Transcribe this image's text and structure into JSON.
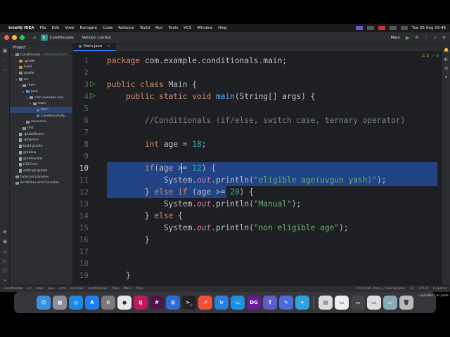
{
  "menubar": {
    "app_name": "IntelliJ IDEA",
    "items": [
      "File",
      "Edit",
      "View",
      "Navigate",
      "Code",
      "Refactor",
      "Build",
      "Run",
      "Tools",
      "VCS",
      "Window",
      "Help"
    ],
    "clock": "Tue 26 Aug 19:46"
  },
  "titlebar": {
    "project_badge": "C",
    "project_name": "Conditionals",
    "vcs_label": "Version control",
    "run_config": "Main"
  },
  "project_panel": {
    "title": "Project",
    "tree": [
      {
        "label": "Conditionals",
        "muted": "~/Desktop/Tech...",
        "depth": 0,
        "arrow": "▾",
        "icon": "folder"
      },
      {
        "label": ".gradle",
        "depth": 1,
        "arrow": "›",
        "icon": "folder-orange"
      },
      {
        "label": "build",
        "depth": 1,
        "arrow": "›",
        "icon": "folder-orange"
      },
      {
        "label": "gradle",
        "depth": 1,
        "arrow": "›",
        "icon": "folder"
      },
      {
        "label": "src",
        "depth": 1,
        "arrow": "▾",
        "icon": "folder"
      },
      {
        "label": "main",
        "depth": 2,
        "arrow": "▾",
        "icon": "folder"
      },
      {
        "label": "java",
        "depth": 3,
        "arrow": "▾",
        "icon": "folder-blue"
      },
      {
        "label": "com.example.con...",
        "depth": 4,
        "arrow": "▾",
        "icon": "folder"
      },
      {
        "label": "main",
        "depth": 5,
        "arrow": "▾",
        "icon": "folder"
      },
      {
        "label": "Main",
        "depth": 6,
        "arrow": "",
        "icon": "class",
        "selected": true
      },
      {
        "label": "ConditionalsAp...",
        "depth": 6,
        "arrow": "",
        "icon": "class"
      },
      {
        "label": "resources",
        "depth": 3,
        "arrow": "›",
        "icon": "folder"
      },
      {
        "label": "test",
        "depth": 2,
        "arrow": "›",
        "icon": "folder"
      },
      {
        "label": ".gitattributes",
        "depth": 1,
        "arrow": "",
        "icon": "file"
      },
      {
        "label": ".gitignore",
        "depth": 1,
        "arrow": "",
        "icon": "file"
      },
      {
        "label": "build.gradle",
        "depth": 1,
        "arrow": "",
        "icon": "file"
      },
      {
        "label": "gradlew",
        "depth": 1,
        "arrow": "",
        "icon": "file"
      },
      {
        "label": "gradlew.bat",
        "depth": 1,
        "arrow": "",
        "icon": "file"
      },
      {
        "label": "HELP.md",
        "depth": 1,
        "arrow": "",
        "icon": "file"
      },
      {
        "label": "settings.gradle",
        "depth": 1,
        "arrow": "",
        "icon": "file"
      },
      {
        "label": "External Libraries",
        "depth": 0,
        "arrow": "›",
        "icon": "folder"
      },
      {
        "label": "Scratches and Consoles",
        "depth": 0,
        "arrow": "›",
        "icon": "folder"
      }
    ]
  },
  "editor": {
    "tab_label": "Main.java",
    "inspection": {
      "warnings": "⚠ 2",
      "ok": "✓ 6"
    },
    "lines": [
      {
        "n": "1",
        "tokens": [
          [
            "kw",
            "package "
          ],
          [
            "",
            "com.example.conditionals.main;"
          ]
        ]
      },
      {
        "n": "2",
        "tokens": []
      },
      {
        "n": "3",
        "run": true,
        "tokens": [
          [
            "kw",
            "public class "
          ],
          [
            "",
            "Main {"
          ]
        ]
      },
      {
        "n": "4",
        "run": true,
        "tokens": [
          [
            "",
            "    "
          ],
          [
            "kw",
            "public static void "
          ],
          [
            "fn",
            "main"
          ],
          [
            "",
            "(String[] args) {"
          ]
        ]
      },
      {
        "n": "5",
        "tokens": []
      },
      {
        "n": "6",
        "tokens": [
          [
            "",
            "        "
          ],
          [
            "cm",
            "//Conditionals (if/else, switch case, ternary operator)"
          ]
        ]
      },
      {
        "n": "7",
        "tokens": []
      },
      {
        "n": "8",
        "tokens": [
          [
            "",
            "        "
          ],
          [
            "kw",
            "int "
          ],
          [
            "",
            "age = "
          ],
          [
            "num",
            "18"
          ],
          [
            "",
            ";"
          ]
        ]
      },
      {
        "n": "9",
        "tokens": []
      },
      {
        "n": "10",
        "current": true,
        "tokens": [
          [
            "",
            "        "
          ],
          [
            "kw",
            "if"
          ],
          [
            "",
            "(age >= "
          ],
          [
            "num",
            "12"
          ],
          [
            "",
            ") {"
          ]
        ]
      },
      {
        "n": "11",
        "tokens": [
          [
            "",
            "            System."
          ],
          [
            "fld",
            "out"
          ],
          [
            "",
            ".println("
          ],
          [
            "str",
            "\"eligible age(uvgun yash)\""
          ],
          [
            "",
            ");"
          ]
        ]
      },
      {
        "n": "12",
        "tokens": [
          [
            "",
            "        } "
          ],
          [
            "kw",
            "else if "
          ],
          [
            "",
            "(age >= "
          ],
          [
            "num",
            "20"
          ],
          [
            "",
            ") {"
          ]
        ]
      },
      {
        "n": "13",
        "tokens": [
          [
            "",
            "            System."
          ],
          [
            "fld",
            "out"
          ],
          [
            "",
            ".println("
          ],
          [
            "str",
            "\"Manual\""
          ],
          [
            "",
            ");"
          ]
        ]
      },
      {
        "n": "14",
        "tokens": [
          [
            "",
            "        } "
          ],
          [
            "kw",
            "else "
          ],
          [
            "",
            "{"
          ]
        ]
      },
      {
        "n": "15",
        "tokens": [
          [
            "",
            "            System."
          ],
          [
            "fld",
            "out"
          ],
          [
            "",
            ".println("
          ],
          [
            "str",
            "\"non eligible age\""
          ],
          [
            "",
            ");"
          ]
        ]
      },
      {
        "n": "16",
        "tokens": [
          [
            "",
            "        }"
          ]
        ]
      },
      {
        "n": "17",
        "tokens": []
      },
      {
        "n": "18",
        "tokens": []
      },
      {
        "n": "19",
        "tokens": [
          [
            "",
            "    }"
          ]
        ]
      }
    ]
  },
  "breadcrumbs": {
    "items": [
      "Conditionals",
      "src",
      "main",
      "java",
      "com",
      "example",
      "conditionals",
      "main",
      "Main",
      "main"
    ],
    "status": [
      "15:18 (96 chars, 2 line breaks)",
      "LF",
      "UTF-8",
      "4 spaces"
    ]
  },
  "dock": {
    "apps": [
      {
        "name": "finder",
        "color": "#3b8fe0",
        "glyph": "☺"
      },
      {
        "name": "launchpad",
        "color": "#8a8f99",
        "glyph": "▦"
      },
      {
        "name": "safari",
        "color": "#1e88e5",
        "glyph": "◎"
      },
      {
        "name": "app-store",
        "color": "#1c7ef0",
        "glyph": "A"
      },
      {
        "name": "settings",
        "color": "#7a7a7a",
        "glyph": "⚙"
      },
      {
        "name": "chrome",
        "color": "#e8e8e8",
        "glyph": "●"
      },
      {
        "name": "intellij",
        "color": "#c2185b",
        "glyph": "IJ"
      },
      {
        "name": "slack",
        "color": "#4a154b",
        "glyph": "#"
      },
      {
        "name": "windows-app",
        "color": "#2d6bd6",
        "glyph": "⊞"
      },
      {
        "name": "terminal",
        "color": "#222",
        "glyph": ">_"
      },
      {
        "name": "swift",
        "color": "#f05138",
        "glyph": "↗"
      },
      {
        "name": "sync",
        "color": "#2a7de1",
        "glyph": "↻"
      },
      {
        "name": "docker",
        "color": "#1d90e8",
        "glyph": "🐳"
      },
      {
        "name": "datagrip",
        "color": "#6a1b9a",
        "glyph": "DG"
      },
      {
        "name": "teams",
        "color": "#5b5fc7",
        "glyph": "T"
      },
      {
        "name": "notes",
        "color": "#4b6cd8",
        "glyph": "✎"
      },
      {
        "name": "telegram",
        "color": "#2aa3e0",
        "glyph": "✈"
      }
    ],
    "recent": [
      {
        "name": "doc",
        "color": "#dcdcdc",
        "glyph": "▤"
      },
      {
        "name": "window-1",
        "color": "#eeeeee",
        "glyph": "▭"
      },
      {
        "name": "window-2",
        "color": "#444",
        "glyph": "▭"
      },
      {
        "name": "window-3",
        "color": "#ddd",
        "glyph": "▭"
      },
      {
        "name": "window-4",
        "color": "#8ab",
        "glyph": "▭"
      },
      {
        "name": "trash",
        "color": "#bbb",
        "glyph": "🗑"
      }
    ]
  },
  "desktop_file": "...crp/callba ...ac.paste"
}
